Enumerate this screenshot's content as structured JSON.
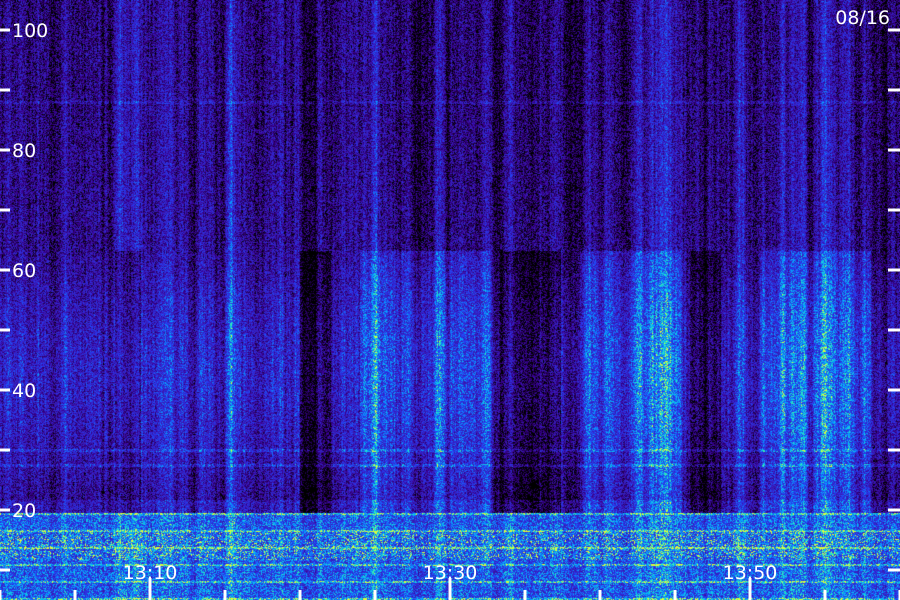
{
  "chart_data": {
    "type": "heatmap",
    "date_label": "08/16",
    "y_axis": {
      "range": [
        17,
        105
      ],
      "labeled_ticks": [
        {
          "value": 100,
          "label": "100"
        },
        {
          "value": 80,
          "label": "80"
        },
        {
          "value": 60,
          "label": "60"
        },
        {
          "value": 40,
          "label": "40"
        },
        {
          "value": 20,
          "label": "20"
        }
      ],
      "minor_ticks": [
        90,
        70,
        50,
        30,
        10
      ]
    },
    "x_axis": {
      "labeled_ticks": [
        {
          "value": "13:10",
          "label": "13:10"
        },
        {
          "value": "13:30",
          "label": "13:30"
        },
        {
          "value": "13:50",
          "label": "13:50"
        }
      ],
      "minor_interval_minutes": 5
    },
    "colormap": [
      "#000000",
      "#1a0040",
      "#3a10c8",
      "#2a6cff",
      "#00c8ff",
      "#40ffa0",
      "#ffff00"
    ],
    "features": {
      "strong_band": {
        "from": 17,
        "to": 19.5
      },
      "faint_line": 88,
      "bands": [
        30,
        27.5
      ]
    }
  }
}
